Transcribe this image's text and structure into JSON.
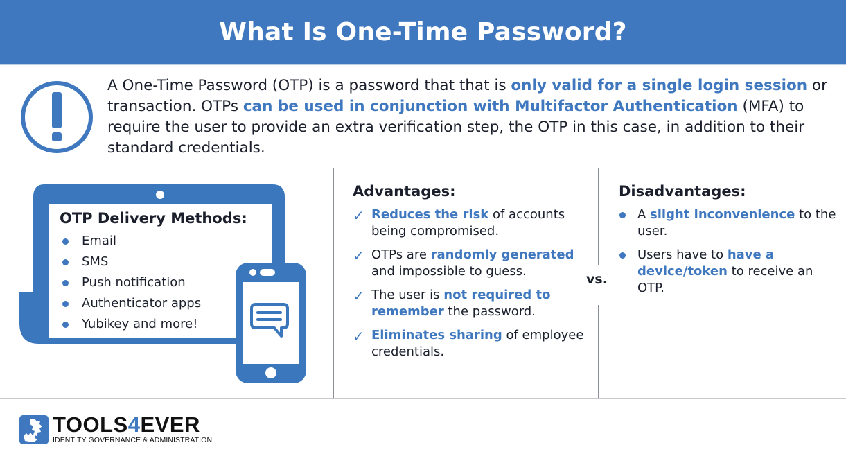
{
  "header": {
    "title": "What Is One-Time Password?"
  },
  "intro": {
    "icon": "exclamation-circle-icon",
    "segments": [
      {
        "text": "A One-Time Password (OTP) is a password that that is ",
        "highlight": false
      },
      {
        "text": "only valid for a single login session",
        "highlight": true
      },
      {
        "text": " or transaction. OTPs ",
        "highlight": false
      },
      {
        "text": "can be used in conjunction with Multifactor Authentication",
        "highlight": true
      },
      {
        "text": " (MFA) to require the user to provide an extra verification step, the OTP in this case, in addition to their standard credentials.",
        "highlight": false
      }
    ]
  },
  "delivery": {
    "title": "OTP Delivery Methods:",
    "icons": [
      "laptop-icon",
      "smartphone-icon",
      "chat-bubble-icon"
    ],
    "items": [
      "Email",
      "SMS",
      "Push notification",
      "Authenticator apps",
      "Yubikey and more!"
    ]
  },
  "advantages": {
    "title": "Advantages:",
    "icon": "checkmark-icon",
    "items": [
      [
        {
          "text": "Reduces the risk",
          "highlight": true
        },
        {
          "text": " of accounts being compromised.",
          "highlight": false
        }
      ],
      [
        {
          "text": "OTPs are ",
          "highlight": false
        },
        {
          "text": "randomly generated",
          "highlight": true
        },
        {
          "text": " and impossible to guess.",
          "highlight": false
        }
      ],
      [
        {
          "text": "The user is ",
          "highlight": false
        },
        {
          "text": "not required to remember",
          "highlight": true
        },
        {
          "text": " the password.",
          "highlight": false
        }
      ],
      [
        {
          "text": "Eliminates sharing",
          "highlight": true
        },
        {
          "text": " of employee credentials.",
          "highlight": false
        }
      ]
    ]
  },
  "versus": "vs.",
  "disadvantages": {
    "title": "Disadvantages:",
    "items": [
      [
        {
          "text": "A ",
          "highlight": false
        },
        {
          "text": "slight inconvenience",
          "highlight": true
        },
        {
          "text": " to the user.",
          "highlight": false
        }
      ],
      [
        {
          "text": "Users have to ",
          "highlight": false
        },
        {
          "text": "have a device/token",
          "highlight": true
        },
        {
          "text": " to receive an OTP.",
          "highlight": false
        }
      ]
    ]
  },
  "footer": {
    "logo_icon": "tools4ever-logo-icon",
    "brand_prefix": "TOOLS",
    "brand_number": "4",
    "brand_suffix": "EVER",
    "tagline": "IDENTITY GOVERNANCE & ADMINISTRATION"
  },
  "colors": {
    "accent": "#3f78bf",
    "text": "#1a1f2b",
    "banner": "#3f78bf",
    "divider": "#8a8f96"
  }
}
